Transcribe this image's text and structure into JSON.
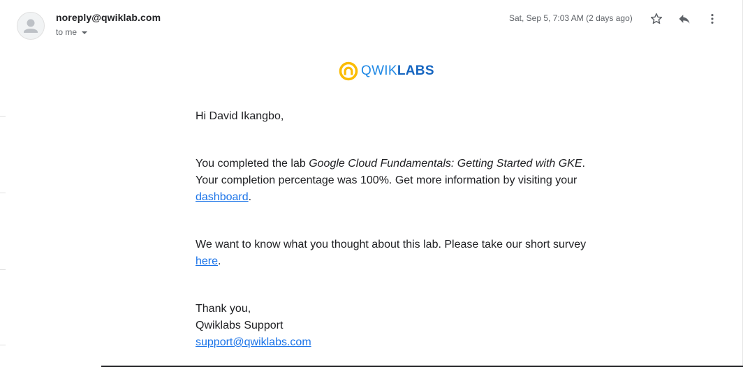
{
  "header": {
    "sender": "noreply@qwiklab.com",
    "recipient_label": "to me",
    "date": "Sat, Sep 5, 7:03 AM (2 days ago)",
    "icons": {
      "avatar": "person-avatar-icon",
      "star": "star-icon",
      "reply": "reply-icon",
      "more": "more-vertical-icon",
      "recipient_toggle": "caret-down-icon"
    }
  },
  "logo": {
    "text_light": "QWIK",
    "text_bold": "LABS",
    "icon": "qwiklabs-logo-icon",
    "colors": {
      "ring": "#fbbc04",
      "text": "#1e88e5"
    }
  },
  "email": {
    "greeting": "Hi David Ikangbo,",
    "para1_prefix": "You completed the lab ",
    "lab_name": "Google Cloud Fundamentals: Getting Started with GKE",
    "para1_middle": ". Your completion percentage was 100%. Get more information by visiting your ",
    "dashboard_link": "dashboard",
    "para1_suffix": ".",
    "para2_prefix": "We want to know what you thought about this lab. Please take our short survey ",
    "survey_link": "here",
    "para2_suffix": ".",
    "signoff": "Thank you,",
    "signature": "Qwiklabs Support",
    "support_email": "support@qwiklabs.com"
  },
  "colors": {
    "link": "#1a73e8",
    "text": "#202124",
    "muted": "#5f6368"
  }
}
